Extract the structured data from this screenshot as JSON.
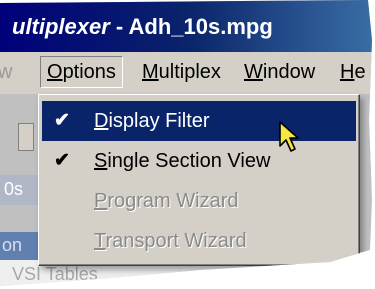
{
  "window": {
    "title_app": "ultiplexer",
    "title_separator": " - ",
    "title_file": "Adh_10s.mpg"
  },
  "menubar": {
    "view": "w",
    "options_accel": "O",
    "options_rest": "ptions",
    "multiplex_accel": "M",
    "multiplex_rest": "ultiplex",
    "window_accel": "W",
    "window_rest": "indow",
    "help_accel": "H",
    "help_rest": "e"
  },
  "dropdown": {
    "items": [
      {
        "accel": "D",
        "rest": "isplay Filter",
        "checked": true,
        "enabled": true,
        "highlighted": true
      },
      {
        "accel": "S",
        "rest": "ingle Section View",
        "checked": true,
        "enabled": true,
        "highlighted": false
      },
      {
        "accel": "P",
        "rest": "rogram Wizard",
        "checked": false,
        "enabled": false,
        "highlighted": false
      },
      {
        "accel": "T",
        "rest": "ransport Wizard",
        "checked": false,
        "enabled": false,
        "highlighted": false
      }
    ],
    "check_glyph": "✔"
  },
  "background": {
    "os_fragment": "0s",
    "on_fragment": "on",
    "vsi_fragment": "VSI Tables"
  },
  "colors": {
    "titlebar": "#0a246a",
    "highlight": "#0a246a",
    "menu_face": "#d4d0c8",
    "cursor_fill": "#f5e642"
  },
  "cursor_icon": "arrow-pointer-icon"
}
